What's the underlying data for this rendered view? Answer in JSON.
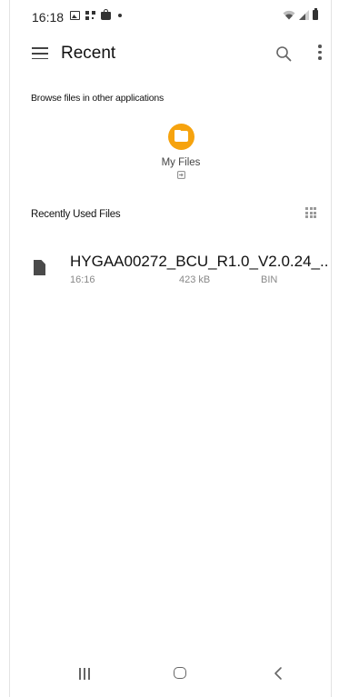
{
  "status_bar": {
    "time": "16:18",
    "left_icons": [
      "gallery-icon",
      "qr-code-icon",
      "shopping-bag-icon",
      "notification-dot-icon"
    ],
    "right_icons": [
      "wifi-icon",
      "signal-icon",
      "battery-icon"
    ]
  },
  "app_bar": {
    "title": "Recent",
    "icons": [
      "menu-icon",
      "search-icon",
      "more-options-icon"
    ]
  },
  "browse_section": {
    "header": "Browse files in other applications",
    "apps": [
      {
        "label": "My Files",
        "icon": "my-files-app-icon",
        "accent": "#f6a30e"
      }
    ]
  },
  "recent_section": {
    "header": "Recently Used Files",
    "view_toggle_icon": "grid-view-icon",
    "files": [
      {
        "name": "HYGAA00272_BCU_R1.0_V2.0.24_...",
        "time": "16:16",
        "size": "423 kB",
        "type": "BIN",
        "icon": "file-icon"
      }
    ]
  },
  "nav_bar": {
    "buttons": [
      "recent-apps-icon",
      "home-icon",
      "back-icon"
    ]
  }
}
